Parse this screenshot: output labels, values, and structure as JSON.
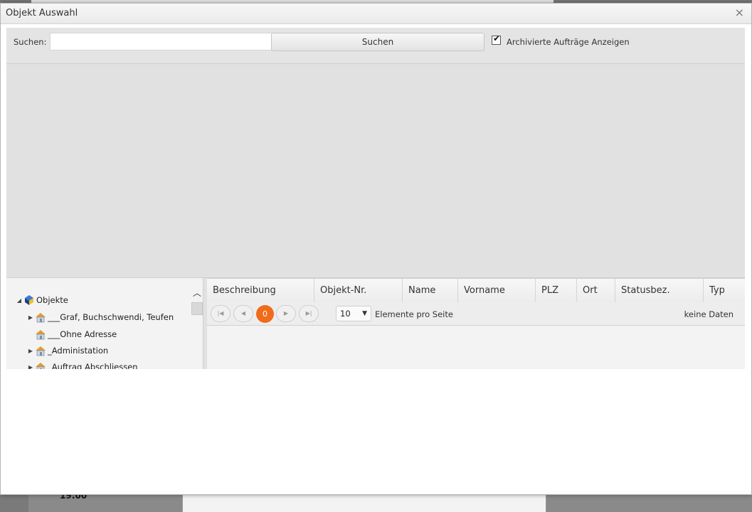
{
  "background": {
    "time_label": "19:00"
  },
  "window": {
    "title": "Objekt Auswahl",
    "close_glyph": "×"
  },
  "search": {
    "label": "Suchen:",
    "value": "",
    "placeholder": "",
    "button_label": "Suchen",
    "archived_checked": true,
    "archived_label": "Archivierte Aufträge Anzeigen"
  },
  "tree": {
    "root_label": "Objekte",
    "items": [
      {
        "label": "___Graf, Buchschwendi, Teufen",
        "expandable": true
      },
      {
        "label": "___Ohne Adresse",
        "expandable": false
      },
      {
        "label": "_Administation",
        "expandable": true
      },
      {
        "label": "_Auftrag Abschliessen",
        "expandable": true
      }
    ]
  },
  "grid": {
    "columns": [
      "Beschreibung",
      "Objekt-Nr.",
      "Name",
      "Vorname",
      "PLZ",
      "Ort",
      "Statusbez.",
      "Typ"
    ],
    "rows": []
  },
  "pager": {
    "current_page": "0",
    "page_size": "10",
    "page_size_label": "Elemente pro Seite",
    "info": "keine Daten"
  },
  "colors": {
    "accent": "#f06b1b",
    "panel": "#e1e1e1"
  }
}
